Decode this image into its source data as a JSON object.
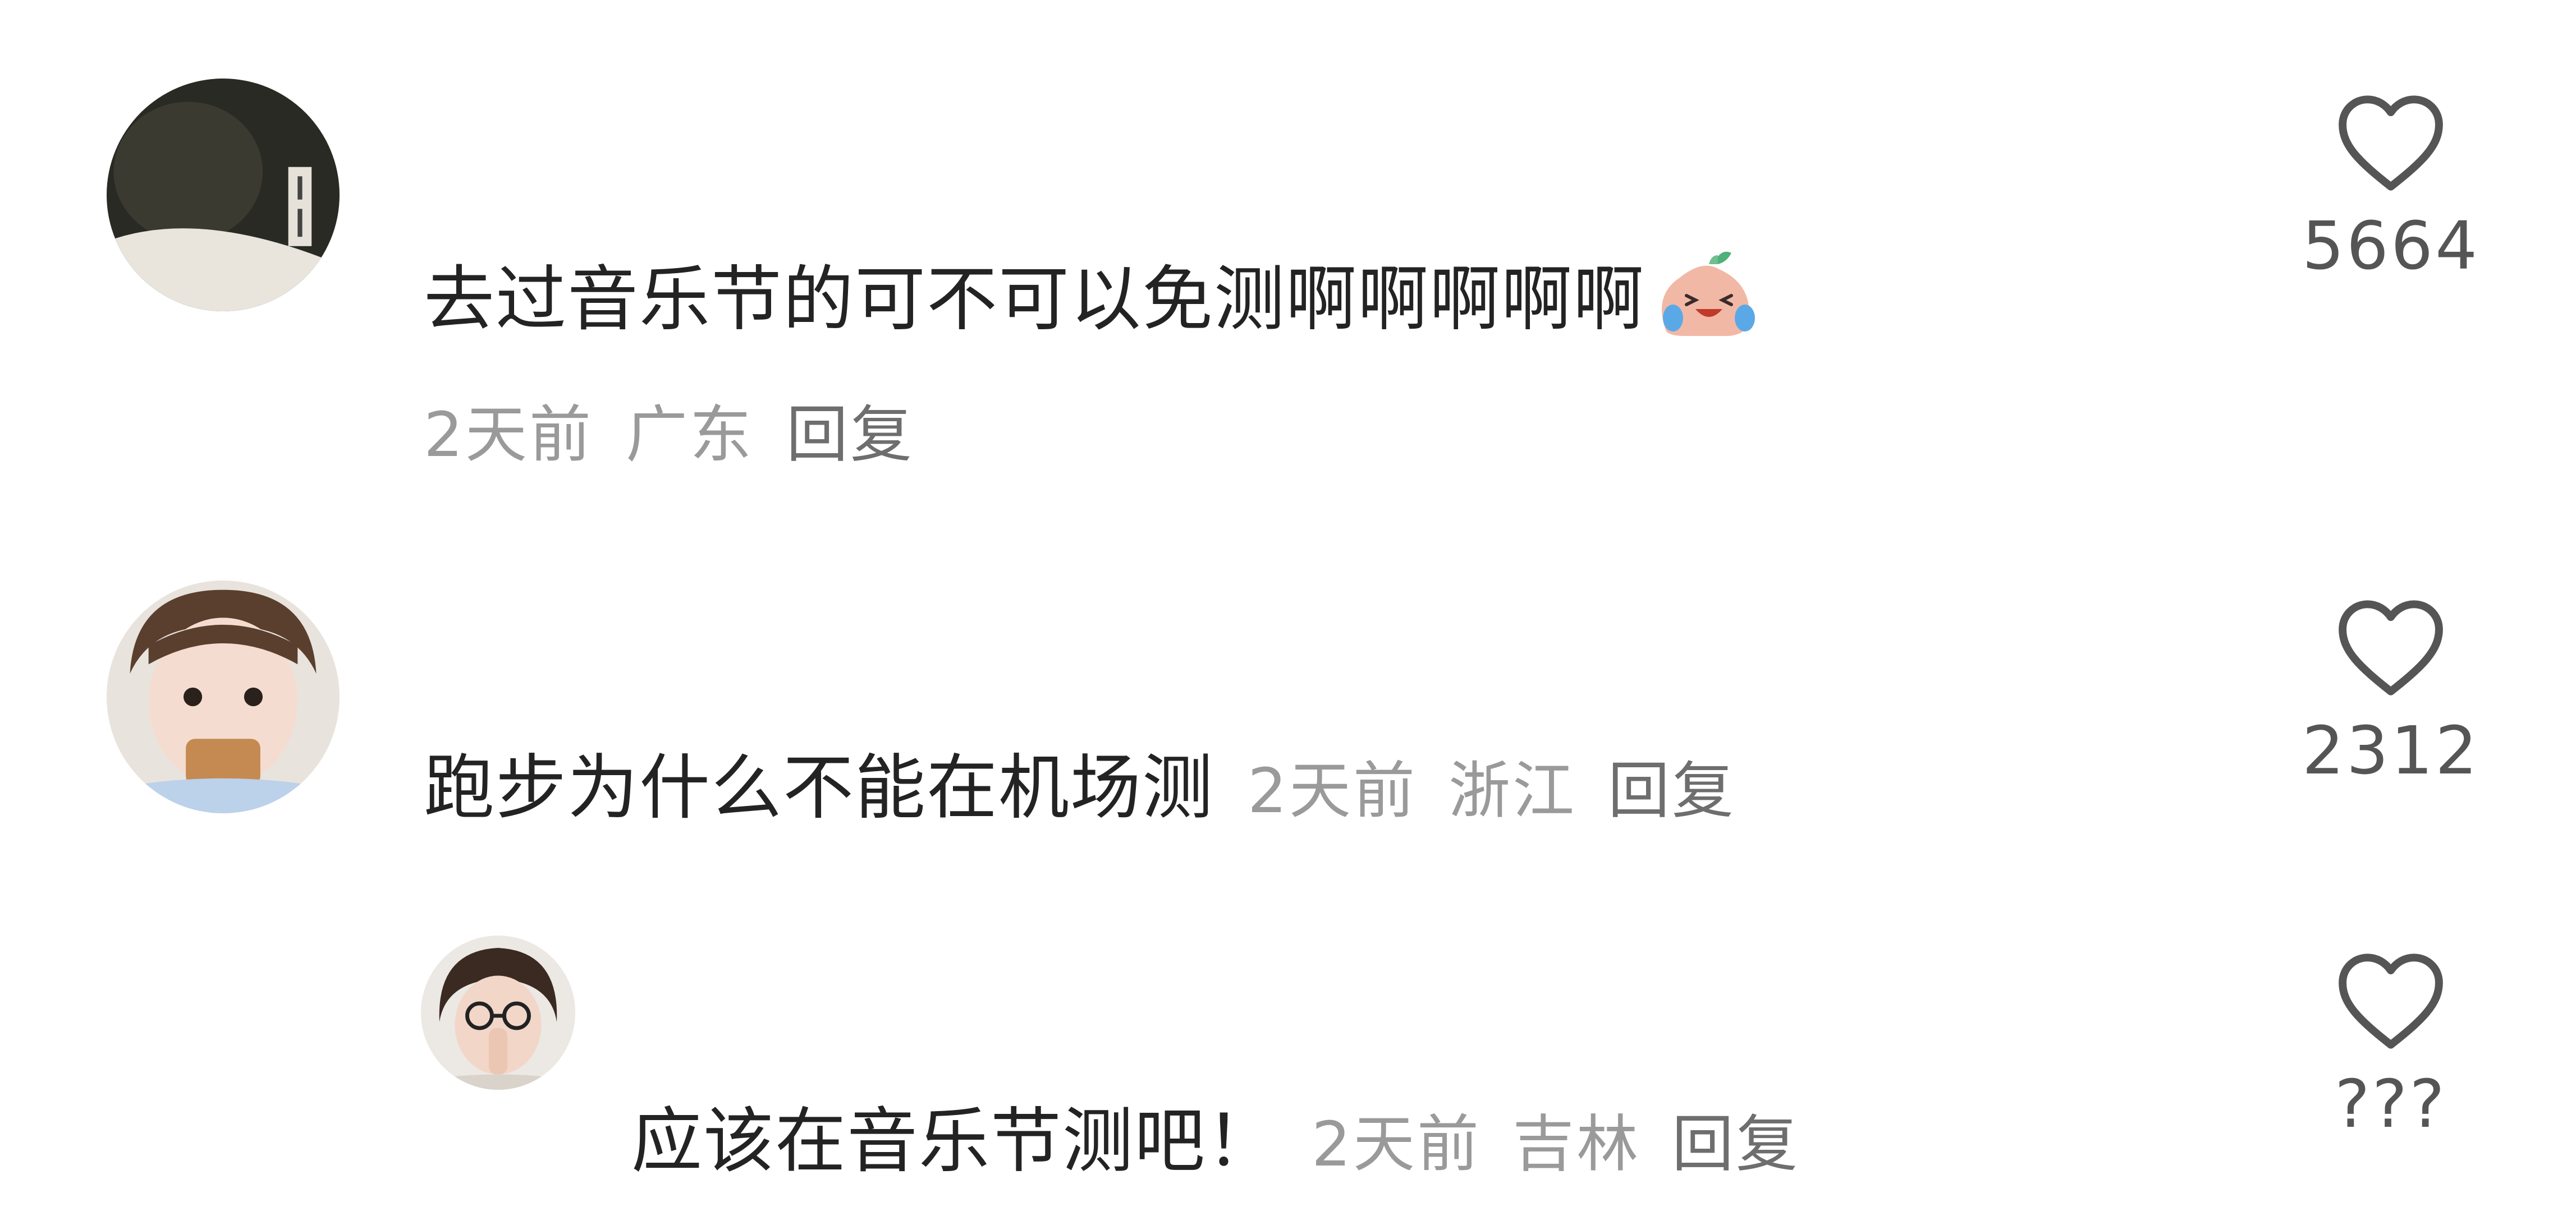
{
  "comments": [
    {
      "text": "去过音乐节的可不可以免测啊啊啊啊啊",
      "emoji": "laughing-crying-emoji",
      "time": "2天前",
      "location": "广东",
      "reply": "回复",
      "likes": "5664"
    },
    {
      "text": "跑步为什么不能在机场测",
      "time": "2天前",
      "location": "浙江",
      "reply": "回复",
      "likes": "2312"
    },
    {
      "text": "应该在音乐节测吧！",
      "time": "2天前",
      "location": "吉林",
      "reply": "回复",
      "likes": "???"
    }
  ],
  "icons": {
    "like": "heart-outline-icon"
  },
  "colors": {
    "background": "#ffffff",
    "comment_text": "#232323",
    "meta_text": "#9a9a9a",
    "reply_text": "#6e6e6e",
    "like_icon": "#555555"
  }
}
